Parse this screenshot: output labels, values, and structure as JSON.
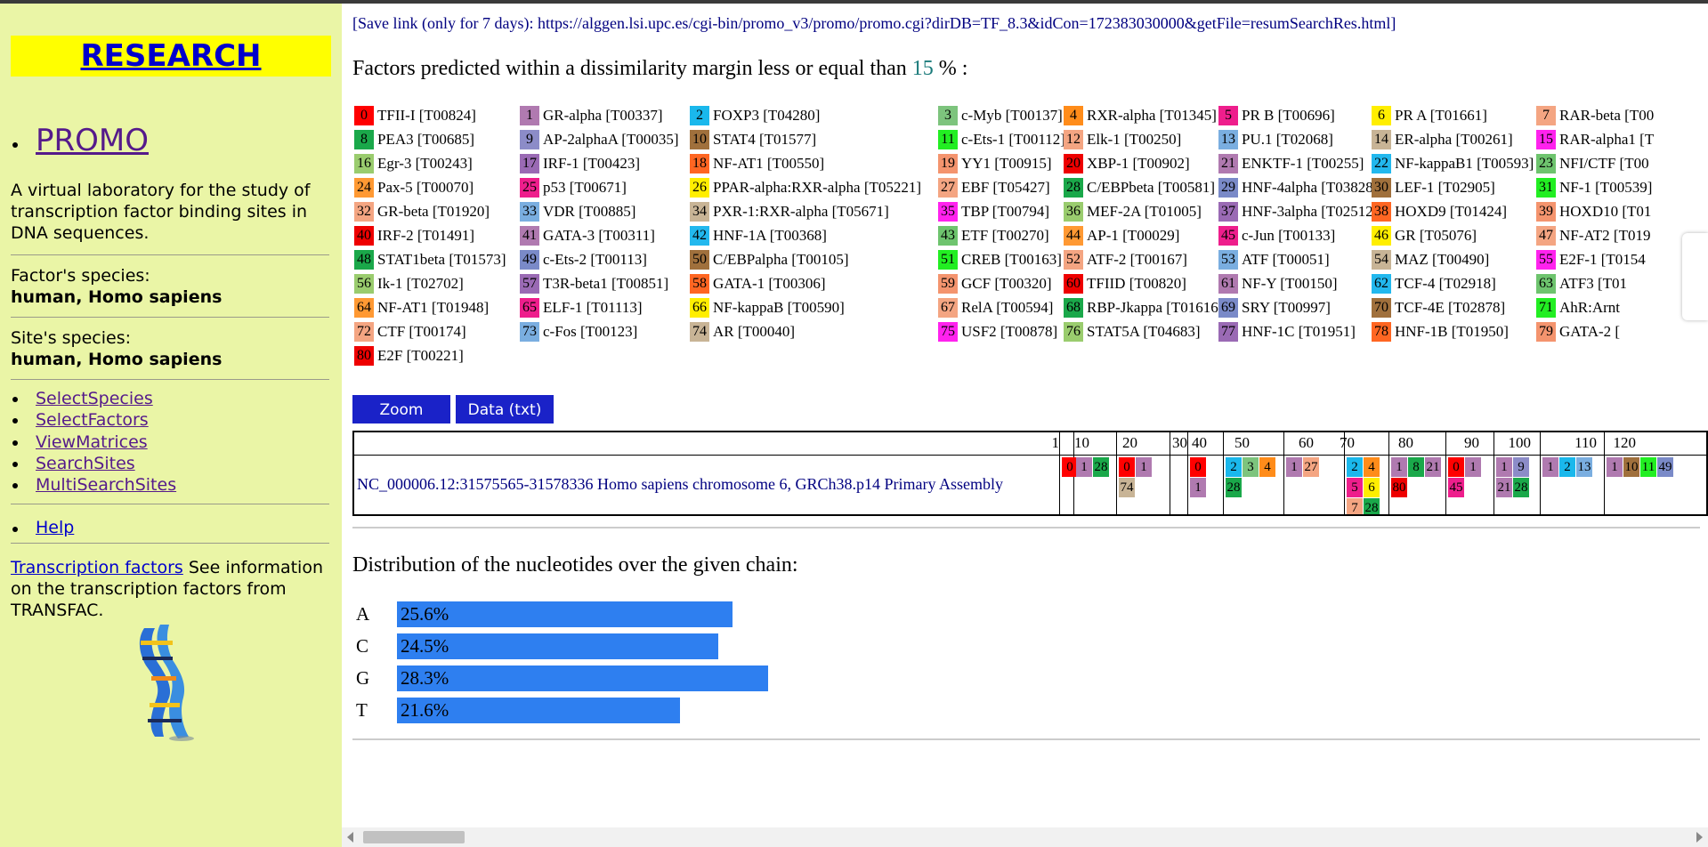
{
  "sidebar": {
    "research": "RESEARCH",
    "promo": "PROMO",
    "description": "A virtual laboratory for the study of transcription factor binding sites in DNA sequences.",
    "factor_species_label": "Factor's species:",
    "factor_species": "human, Homo sapiens",
    "site_species_label": "Site's species:",
    "site_species": "human, Homo sapiens",
    "links": [
      "SelectSpecies",
      "SelectFactors",
      "ViewMatrices",
      "SearchSites",
      "MultiSearchSites"
    ],
    "help": "Help",
    "tf_link": "Transcription factors",
    "tf_text": " See information on the transcription factors from TRANSFAC."
  },
  "main": {
    "save_link": "[Save link (only for 7 days): https://alggen.lsi.upc.es/cgi-bin/promo_v3/promo/promo.cgi?dirDB=TF_8.3&idCon=172383030000&getFile=resumSearchRes.html]",
    "heading_pre": "Factors predicted within a dissimilarity margin less or equal than ",
    "heading_num": "15",
    "heading_post": " % :",
    "zoom": "Zoom",
    "data_txt": "Data (txt)",
    "seq_name": "NC_000006.12:31575565-31578336 Homo sapiens chromosome 6, GRCh38.p14 Primary Assembly",
    "ticks": [
      "1",
      "10",
      "20",
      "30",
      "40",
      "50",
      "60",
      "70",
      "80",
      "90",
      "100",
      "110",
      "120"
    ],
    "dist_title": "Distribution of the nucleotides over the given chain:"
  },
  "factors": [
    {
      "n": "0",
      "label": "TFII-I [T00824]",
      "color": "#ff0000"
    },
    {
      "n": "1",
      "label": "GR-alpha [T00337]",
      "color": "#b07ab0"
    },
    {
      "n": "2",
      "label": "FOXP3 [T04280]",
      "color": "#1ab8ec"
    },
    {
      "n": "3",
      "label": "c-Myb [T00137]",
      "color": "#7dc47d"
    },
    {
      "n": "4",
      "label": "RXR-alpha [T01345]",
      "color": "#ff8c1a"
    },
    {
      "n": "5",
      "label": "PR B [T00696]",
      "color": "#ee1e8c"
    },
    {
      "n": "6",
      "label": "PR A [T01661]",
      "color": "#ffee00"
    },
    {
      "n": "7",
      "label": "RAR-beta [T00",
      "color": "#f4a582"
    },
    {
      "n": "8",
      "label": "PEA3 [T00685]",
      "color": "#1aa84a"
    },
    {
      "n": "9",
      "label": "AP-2alphaA [T00035]",
      "color": "#8c8cc8"
    },
    {
      "n": "10",
      "label": "STAT4 [T01577]",
      "color": "#a0703c"
    },
    {
      "n": "11",
      "label": "c-Ets-1 [T00112]",
      "color": "#22ee22"
    },
    {
      "n": "12",
      "label": "Elk-1 [T00250]",
      "color": "#f4a582"
    },
    {
      "n": "13",
      "label": "PU.1 [T02068]",
      "color": "#7aaee0"
    },
    {
      "n": "14",
      "label": "ER-alpha [T00261]",
      "color": "#c8b496"
    },
    {
      "n": "15",
      "label": "RAR-alpha1 [T",
      "color": "#ff22ee"
    },
    {
      "n": "16",
      "label": "Egr-3 [T00243]",
      "color": "#9acc6e"
    },
    {
      "n": "17",
      "label": "IRF-1 [T00423]",
      "color": "#9a6ab4"
    },
    {
      "n": "18",
      "label": "NF-AT1 [T00550]",
      "color": "#ff6622"
    },
    {
      "n": "19",
      "label": "YY1 [T00915]",
      "color": "#f4946e"
    },
    {
      "n": "20",
      "label": "XBP-1 [T00902]",
      "color": "#ee0000"
    },
    {
      "n": "21",
      "label": "ENKTF-1 [T00255]",
      "color": "#b07ab0"
    },
    {
      "n": "22",
      "label": "NF-kappaB1 [T00593]",
      "color": "#22b8ee"
    },
    {
      "n": "23",
      "label": "NFI/CTF [T00",
      "color": "#6ec46e"
    },
    {
      "n": "24",
      "label": "Pax-5 [T00070]",
      "color": "#ff9933"
    },
    {
      "n": "25",
      "label": "p53 [T00671]",
      "color": "#ee1e8c"
    },
    {
      "n": "26",
      "label": "PPAR-alpha:RXR-alpha [T05221]",
      "color": "#ffee00"
    },
    {
      "n": "27",
      "label": "EBF [T05427]",
      "color": "#f4a582"
    },
    {
      "n": "28",
      "label": "C/EBPbeta [T00581]",
      "color": "#1aa84a"
    },
    {
      "n": "29",
      "label": "HNF-4alpha [T03828]",
      "color": "#7a8ac8"
    },
    {
      "n": "30",
      "label": "LEF-1 [T02905]",
      "color": "#a0703c"
    },
    {
      "n": "31",
      "label": "NF-1 [T00539]",
      "color": "#22ee22"
    },
    {
      "n": "32",
      "label": "GR-beta [T01920]",
      "color": "#f4a582"
    },
    {
      "n": "33",
      "label": "VDR [T00885]",
      "color": "#7aaee0"
    },
    {
      "n": "34",
      "label": "PXR-1:RXR-alpha [T05671]",
      "color": "#c8b496"
    },
    {
      "n": "35",
      "label": "TBP [T00794]",
      "color": "#ff22ee"
    },
    {
      "n": "36",
      "label": "MEF-2A [T01005]",
      "color": "#9acc6e"
    },
    {
      "n": "37",
      "label": "HNF-3alpha [T02512]",
      "color": "#9a6ab4"
    },
    {
      "n": "38",
      "label": "HOXD9 [T01424]",
      "color": "#ff6622"
    },
    {
      "n": "39",
      "label": "HOXD10 [T01",
      "color": "#f4946e"
    },
    {
      "n": "40",
      "label": "IRF-2 [T01491]",
      "color": "#ee0000"
    },
    {
      "n": "41",
      "label": "GATA-3 [T00311]",
      "color": "#b07ab0"
    },
    {
      "n": "42",
      "label": "HNF-1A [T00368]",
      "color": "#22b8ee"
    },
    {
      "n": "43",
      "label": "ETF [T00270]",
      "color": "#6ec46e"
    },
    {
      "n": "44",
      "label": "AP-1 [T00029]",
      "color": "#ff9933"
    },
    {
      "n": "45",
      "label": "c-Jun [T00133]",
      "color": "#ee1e8c"
    },
    {
      "n": "46",
      "label": "GR [T05076]",
      "color": "#ffee00"
    },
    {
      "n": "47",
      "label": "NF-AT2 [T019",
      "color": "#f4a582"
    },
    {
      "n": "48",
      "label": "STAT1beta [T01573]",
      "color": "#1aa84a"
    },
    {
      "n": "49",
      "label": "c-Ets-2 [T00113]",
      "color": "#7a8ac8"
    },
    {
      "n": "50",
      "label": "C/EBPalpha [T00105]",
      "color": "#a0703c"
    },
    {
      "n": "51",
      "label": "CREB [T00163]",
      "color": "#22ee22"
    },
    {
      "n": "52",
      "label": "ATF-2 [T00167]",
      "color": "#f4a582"
    },
    {
      "n": "53",
      "label": "ATF [T00051]",
      "color": "#7aaee0"
    },
    {
      "n": "54",
      "label": "MAZ [T00490]",
      "color": "#c8b496"
    },
    {
      "n": "55",
      "label": "E2F-1 [T0154",
      "color": "#ff22ee"
    },
    {
      "n": "56",
      "label": "Ik-1 [T02702]",
      "color": "#9acc6e"
    },
    {
      "n": "57",
      "label": "T3R-beta1 [T00851]",
      "color": "#9a6ab4"
    },
    {
      "n": "58",
      "label": "GATA-1 [T00306]",
      "color": "#ff6622"
    },
    {
      "n": "59",
      "label": "GCF [T00320]",
      "color": "#f4946e"
    },
    {
      "n": "60",
      "label": "TFIID [T00820]",
      "color": "#ee0000"
    },
    {
      "n": "61",
      "label": "NF-Y [T00150]",
      "color": "#b07ab0"
    },
    {
      "n": "62",
      "label": "TCF-4 [T02918]",
      "color": "#22b8ee"
    },
    {
      "n": "63",
      "label": "ATF3 [T01",
      "color": "#6ec46e"
    },
    {
      "n": "64",
      "label": "NF-AT1 [T01948]",
      "color": "#ff9933"
    },
    {
      "n": "65",
      "label": "ELF-1 [T01113]",
      "color": "#ee1e8c"
    },
    {
      "n": "66",
      "label": "NF-kappaB [T00590]",
      "color": "#ffee00"
    },
    {
      "n": "67",
      "label": "RelA [T00594]",
      "color": "#f4a582"
    },
    {
      "n": "68",
      "label": "RBP-Jkappa [T01616]",
      "color": "#1aa84a"
    },
    {
      "n": "69",
      "label": "SRY [T00997]",
      "color": "#7a8ac8"
    },
    {
      "n": "70",
      "label": "TCF-4E [T02878]",
      "color": "#a0703c"
    },
    {
      "n": "71",
      "label": "AhR:Arnt",
      "color": "#22ee22"
    },
    {
      "n": "72",
      "label": "CTF [T00174]",
      "color": "#f4a582"
    },
    {
      "n": "73",
      "label": "c-Fos [T00123]",
      "color": "#7aaee0"
    },
    {
      "n": "74",
      "label": "AR [T00040]",
      "color": "#c8b496"
    },
    {
      "n": "75",
      "label": "USF2 [T00878]",
      "color": "#ff22ee"
    },
    {
      "n": "76",
      "label": "STAT5A [T04683]",
      "color": "#9acc6e"
    },
    {
      "n": "77",
      "label": "HNF-1C [T01951]",
      "color": "#9a6ab4"
    },
    {
      "n": "78",
      "label": "HNF-1B [T01950]",
      "color": "#ff6622"
    },
    {
      "n": "79",
      "label": "GATA-2 [",
      "color": "#f4946e"
    },
    {
      "n": "80",
      "label": "E2F [T00221]",
      "color": "#ee0000"
    }
  ],
  "site_cells": [
    [
      "0"
    ],
    [
      "1",
      "28"
    ],
    [
      "0",
      "1",
      "74"
    ],
    [],
    [
      "0",
      "1"
    ],
    [
      "2",
      "3",
      "4",
      "28"
    ],
    [
      "1",
      "27"
    ],
    [
      "2",
      "4",
      "5",
      "6",
      "7",
      "28"
    ],
    [
      "1",
      "8",
      "21",
      "80"
    ],
    [
      "0",
      "1",
      "45"
    ],
    [
      "1",
      "9",
      "21",
      "28"
    ],
    [
      "1",
      "2",
      "13"
    ],
    [
      "1",
      "10",
      "11",
      "49"
    ]
  ],
  "chart_data": {
    "type": "bar",
    "categories": [
      "A",
      "C",
      "G",
      "T"
    ],
    "values": [
      25.6,
      24.5,
      28.3,
      21.6
    ],
    "value_labels": [
      "25.6%",
      "24.5%",
      "28.3%",
      "21.6%"
    ],
    "title": "Distribution of the nucleotides over the given chain:"
  }
}
